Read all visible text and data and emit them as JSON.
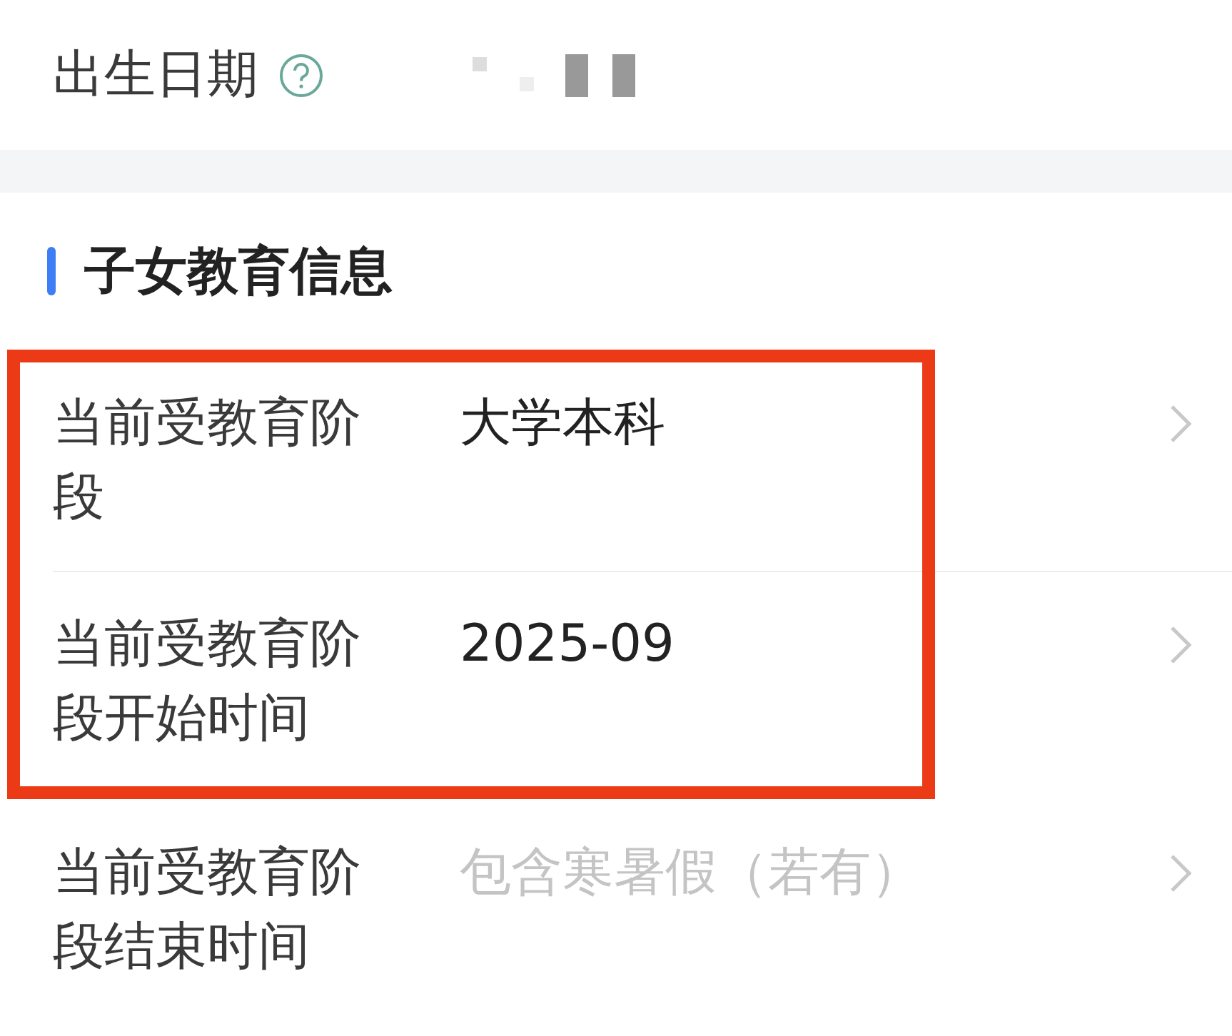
{
  "personal": {
    "label": "出生日期",
    "help_icon": true,
    "value_redacted": true
  },
  "section": {
    "title": "子女教育信息"
  },
  "rows": [
    {
      "label": "当前受教育阶段",
      "value": "大学本科",
      "highlighted": true
    },
    {
      "label": "当前受教育阶段开始时间",
      "value": "2025-09",
      "highlighted": true
    },
    {
      "label": "当前受教育阶段结束时间",
      "placeholder": "包含寒暑假（若有）",
      "highlighted": false
    }
  ]
}
